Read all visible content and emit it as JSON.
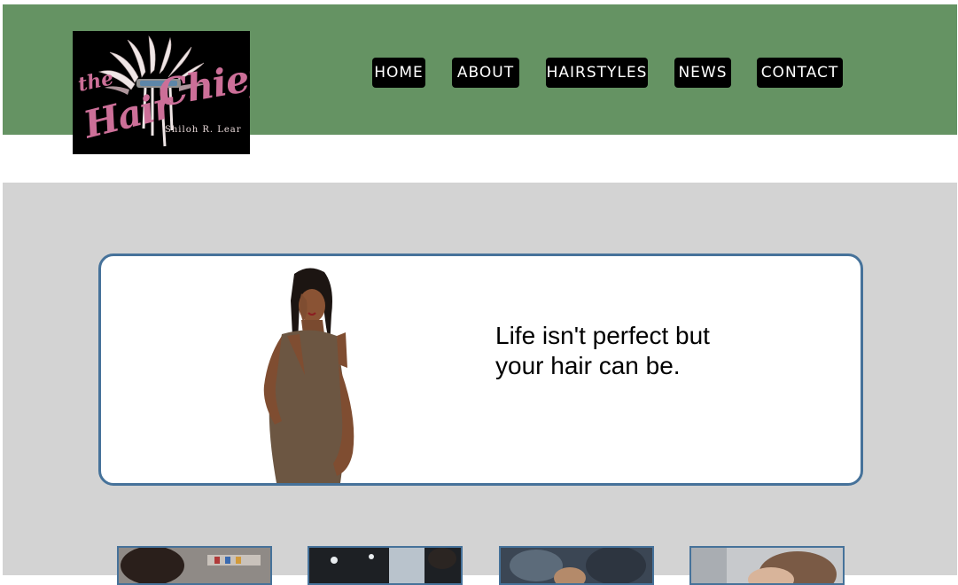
{
  "brand": {
    "logo_the": "the",
    "logo_hair": "Hair",
    "logo_chief": "Chief",
    "logo_sub": "Shiloh R. Lear"
  },
  "nav": {
    "items": [
      {
        "label": "HOME"
      },
      {
        "label": "ABOUT"
      },
      {
        "label": "HAIRSTYLES"
      },
      {
        "label": "NEWS"
      },
      {
        "label": "CONTACT"
      }
    ]
  },
  "hero": {
    "tagline_line1": "Life isn't perfect but",
    "tagline_line2": "your hair can be."
  },
  "colors": {
    "header_bg": "#659363",
    "nav_bg": "#000000",
    "section_bg": "#d3d3d3",
    "card_border": "#46729a",
    "logo_pink": "#cc6f98"
  }
}
